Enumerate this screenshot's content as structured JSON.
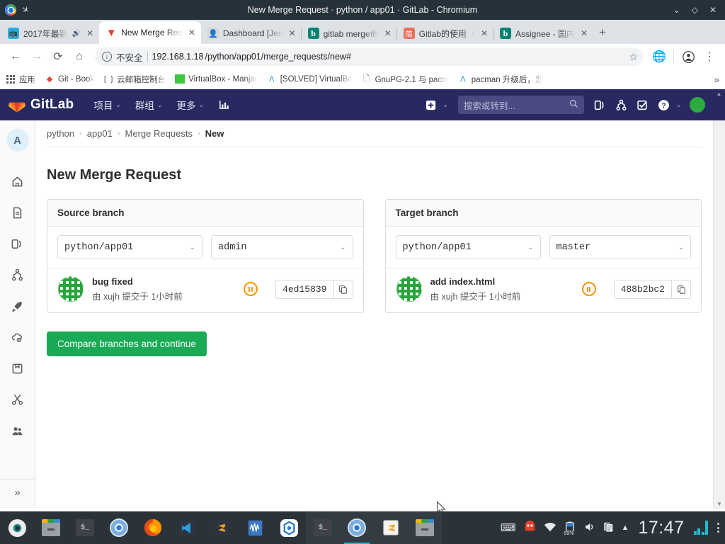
{
  "window": {
    "title": "New Merge Request · python / app01 · GitLab - Chromium",
    "minimize": "⌄",
    "maximize": "◇",
    "close": "✕"
  },
  "tabs": [
    {
      "label": "2017年最新",
      "favicon": "bilibili-icon",
      "audio": "🔊",
      "active": false
    },
    {
      "label": "New Merge Req",
      "favicon": "gitlab-icon",
      "audio": "",
      "active": true
    },
    {
      "label": "Dashboard [Jen",
      "favicon": "jenkins-icon",
      "audio": "",
      "active": false
    },
    {
      "label": "gitlab merge命",
      "favicon": "bing-icon",
      "audio": "",
      "active": false
    },
    {
      "label": "Gitlab的使用（",
      "favicon": "jianshu-icon",
      "audio": "",
      "active": false
    },
    {
      "label": "Assignee - 国内",
      "favicon": "bing-icon",
      "audio": "",
      "active": false
    }
  ],
  "new_tab_label": "+",
  "toolbar": {
    "back": "←",
    "forward": "→",
    "reload": "⟳",
    "home": "⌂",
    "security_label": "不安全",
    "url_host": "192.168.1.18",
    "url_path": "/python/app01/merge_requests/new#",
    "star": "☆",
    "extension": "globe-icon",
    "profile": "person-icon",
    "menu": "⋮"
  },
  "bookmarks": {
    "apps_label": "应用",
    "items": [
      {
        "label": "Git - Book",
        "icon": "diamond-icon"
      },
      {
        "label": "云邮箱控制台",
        "icon": "bracket-icon"
      },
      {
        "label": "VirtualBox - Manjar",
        "icon": "virtualbox-icon"
      },
      {
        "label": "[SOLVED] VirtualBo",
        "icon": "arch-icon"
      },
      {
        "label": "GnuPG-2.1 与 pacm",
        "icon": "page-icon"
      },
      {
        "label": "pacman 升级后，悲",
        "icon": "arch-icon"
      }
    ],
    "overflow": "»"
  },
  "gitlab": {
    "brand": "GitLab",
    "nav_items": [
      {
        "label": "项目",
        "caret": "⌄"
      },
      {
        "label": "群组",
        "caret": "⌄"
      },
      {
        "label": "更多",
        "caret": "⌄"
      }
    ],
    "activity_icon": "chart-icon",
    "plus_label": "+",
    "plus_caret": "⌄",
    "search_placeholder": "搜索或转到...",
    "search_icon": "search-icon",
    "icons": [
      {
        "name": "issues-icon",
        "glyph": "0)"
      },
      {
        "name": "merge-requests-icon",
        "glyph": "⑂"
      },
      {
        "name": "todos-icon",
        "glyph": "☑"
      },
      {
        "name": "help-icon",
        "glyph": "?"
      }
    ],
    "help_caret": "⌄",
    "avatar_caret": "⌄"
  },
  "rail": {
    "avatar_letter": "A",
    "items": [
      {
        "name": "project-overview",
        "icon": "home-icon"
      },
      {
        "name": "repository",
        "icon": "document-icon"
      },
      {
        "name": "issues",
        "icon": "issues-icon"
      },
      {
        "name": "merge-requests",
        "icon": "merge-icon"
      },
      {
        "name": "ci-cd",
        "icon": "rocket-icon"
      },
      {
        "name": "operations",
        "icon": "cloud-gear-icon"
      },
      {
        "name": "packages",
        "icon": "package-icon"
      },
      {
        "name": "snippets",
        "icon": "scissors-icon"
      },
      {
        "name": "members",
        "icon": "members-icon"
      }
    ],
    "collapse": "»"
  },
  "breadcrumb": [
    {
      "label": "python",
      "current": false
    },
    {
      "label": "app01",
      "current": false
    },
    {
      "label": "Merge Requests",
      "current": false
    },
    {
      "label": "New",
      "current": true
    }
  ],
  "breadcrumb_sep": "›",
  "page_title": "New Merge Request",
  "source": {
    "heading": "Source branch",
    "project": "python/app01",
    "branch": "admin",
    "commit_title": "bug fixed",
    "commit_meta": "由 xujh 提交于 1小时前",
    "status_icon": "pipeline-pending-icon",
    "sha": "4ed15839",
    "copy_icon": "copy-icon"
  },
  "target": {
    "heading": "Target branch",
    "project": "python/app01",
    "branch": "master",
    "commit_title": "add index.html",
    "commit_meta": "由 xujh 提交于 1小时前",
    "status_icon": "pipeline-pending-icon",
    "sha": "488b2bc2",
    "copy_icon": "copy-icon"
  },
  "compare_button": "Compare branches and continue",
  "taskbar": {
    "apps": [
      {
        "name": "manjaro-icon"
      },
      {
        "name": "file-manager-icon"
      },
      {
        "name": "terminal-icon"
      },
      {
        "name": "chromium-icon"
      },
      {
        "name": "firefox-icon"
      },
      {
        "name": "vscode-icon"
      },
      {
        "name": "sublime-icon"
      },
      {
        "name": "wireshark-icon"
      },
      {
        "name": "bluefish-icon"
      },
      {
        "name": "terminal-window-icon"
      },
      {
        "name": "chromium-window-icon"
      },
      {
        "name": "sublime-window-icon"
      },
      {
        "name": "file-manager-window-icon"
      }
    ],
    "tray": {
      "keyboard": "⌨",
      "pacman_ghost": "ghost-icon",
      "wifi": "wifi-icon",
      "battery_pct": "59%",
      "volume": "🔊",
      "clipboard": "clipboard-icon",
      "expand": "▲",
      "clock": "17:47",
      "network_graph": "network-graph-icon",
      "menu": "⋮"
    }
  },
  "colors": {
    "gitlab_navy": "#292961",
    "gitlab_orange": "#e24329",
    "green_button": "#1aaa55",
    "pipeline_pending": "#fc9403",
    "taskbar": "#2b3238",
    "accent_cyan": "#1fbbd4"
  }
}
